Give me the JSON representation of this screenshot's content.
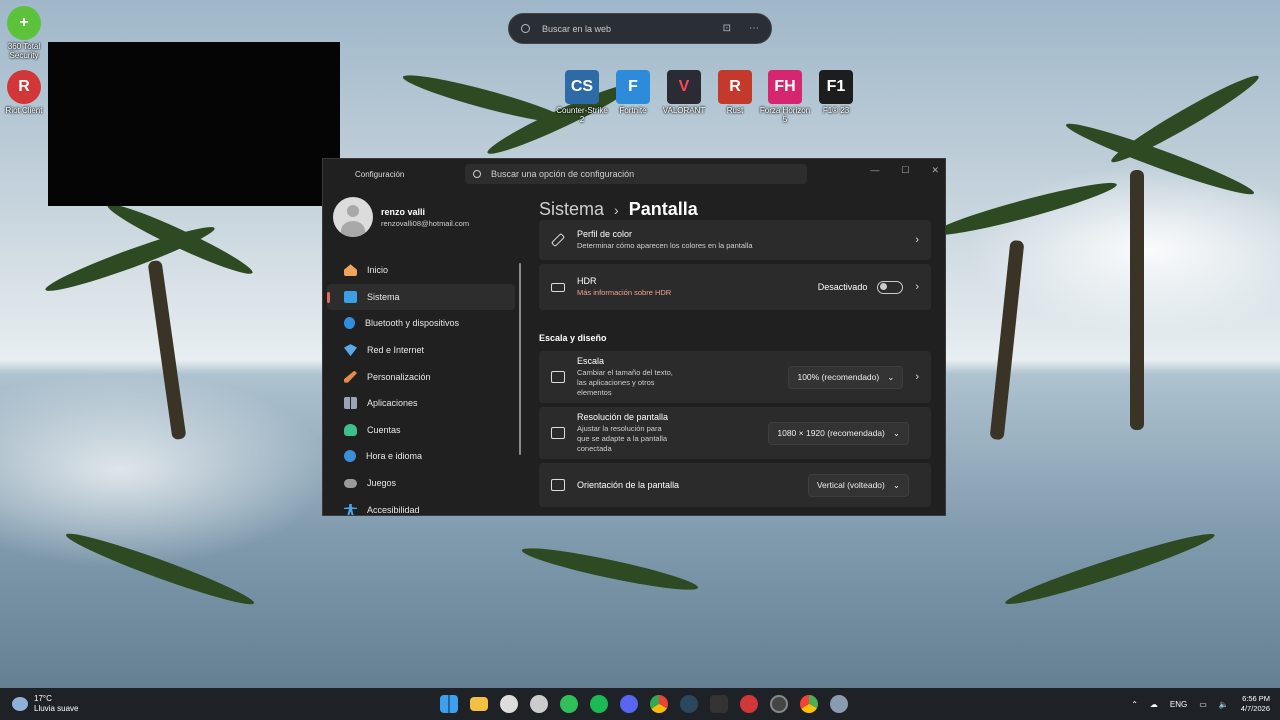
{
  "desktop": {
    "icons_left": [
      {
        "label": "360 Total Security",
        "icon": "360-total-security-icon",
        "color": "#5cc23b"
      },
      {
        "label": "Riot Client",
        "icon": "riot-client-icon",
        "color": "#d13639"
      }
    ],
    "icons_top": [
      {
        "label": "Counter-Strike 2",
        "icon": "counter-strike-icon",
        "color": "#2d6aa6"
      },
      {
        "label": "Fortnite",
        "icon": "fortnite-icon",
        "color": "#2e8bd9"
      },
      {
        "label": "VALORANT",
        "icon": "valorant-icon",
        "color": "#2b2b33"
      },
      {
        "label": "Rust",
        "icon": "rust-icon",
        "color": "#c3392b"
      },
      {
        "label": "Forza Horizon 5",
        "icon": "forza-horizon-icon",
        "color": "#d6266f"
      },
      {
        "label": "F1® 23",
        "icon": "f1-23-icon",
        "color": "#1d1d1d"
      }
    ]
  },
  "web_search": {
    "placeholder": "Buscar en la web"
  },
  "settings": {
    "title": "Configuración",
    "search_placeholder": "Buscar una opción de configuración",
    "controls": {
      "minimize": "—",
      "maximize": "☐",
      "close": "✕"
    },
    "profile": {
      "name": "renzo valli",
      "email": "renzovalli08@hotmail.com"
    },
    "nav": [
      {
        "label": "Inicio",
        "icon": "home-icon",
        "color": "#f0a35a"
      },
      {
        "label": "Sistema",
        "icon": "system-icon",
        "color": "#3b9fe6"
      },
      {
        "label": "Bluetooth y dispositivos",
        "icon": "bluetooth-icon",
        "color": "#2f8ee0"
      },
      {
        "label": "Red e Internet",
        "icon": "network-icon",
        "color": "#5aa9ea"
      },
      {
        "label": "Personalización",
        "icon": "brush-icon",
        "color": "#e48a4a"
      },
      {
        "label": "Aplicaciones",
        "icon": "apps-icon",
        "color": "#9aa6b8"
      },
      {
        "label": "Cuentas",
        "icon": "accounts-icon",
        "color": "#3fbf8a"
      },
      {
        "label": "Hora e idioma",
        "icon": "globe-icon",
        "color": "#3b8fd8"
      },
      {
        "label": "Juegos",
        "icon": "gamepad-icon",
        "color": "#9a9a9a"
      },
      {
        "label": "Accesibilidad",
        "icon": "accessibility-icon",
        "color": "#4aa6ec"
      }
    ],
    "breadcrumb": {
      "parent": "Sistema",
      "separator": "›",
      "current": "Pantalla"
    },
    "cards": {
      "color_profile": {
        "title": "Perfil de color",
        "subtitle": "Determinar cómo aparecen los colores en la pantalla"
      },
      "hdr": {
        "title": "HDR",
        "subtitle": "Más información sobre HDR",
        "status": "Desactivado"
      },
      "section": "Escala y diseño",
      "scale": {
        "title": "Escala",
        "subtitle": "Cambiar el tamaño del texto, las aplicaciones y otros elementos",
        "value": "100% (recomendado)"
      },
      "resolution": {
        "title": "Resolución de pantalla",
        "subtitle": "Ajustar la resolución para que se adapte a la pantalla conectada",
        "value": "1080 × 1920 (recomendada)"
      },
      "orientation": {
        "title": "Orientación de la pantalla",
        "value": "Vertical (volteado)"
      }
    }
  },
  "taskbar": {
    "weather": {
      "temp": "17°C",
      "desc": "Lluvia suave"
    },
    "apps": [
      {
        "icon": "windows-start-icon",
        "color": "#3aa0ef"
      },
      {
        "icon": "file-explorer-icon",
        "color": "#f3c043"
      },
      {
        "icon": "gear-app-icon",
        "color": "#dddddd"
      },
      {
        "icon": "epic-icon",
        "color": "#cccccc"
      },
      {
        "icon": "whatsapp-icon",
        "color": "#2fc05a"
      },
      {
        "icon": "spotify-icon",
        "color": "#1db954"
      },
      {
        "icon": "discord-icon",
        "color": "#5865f2"
      },
      {
        "icon": "chrome-icon",
        "color": "#e8b03b"
      },
      {
        "icon": "steam-icon",
        "color": "#2a475e"
      },
      {
        "icon": "epic-games-icon",
        "color": "#333333"
      },
      {
        "icon": "riot-taskbar-icon",
        "color": "#d13639"
      },
      {
        "icon": "obs-icon",
        "color": "#444444"
      },
      {
        "icon": "chrome-alt-icon",
        "color": "#4caf50"
      },
      {
        "icon": "settings-taskbar-icon",
        "color": "#8a9bb0"
      }
    ],
    "lang": "ENG",
    "time": "6:56 PM",
    "date": "4/7/2026"
  }
}
